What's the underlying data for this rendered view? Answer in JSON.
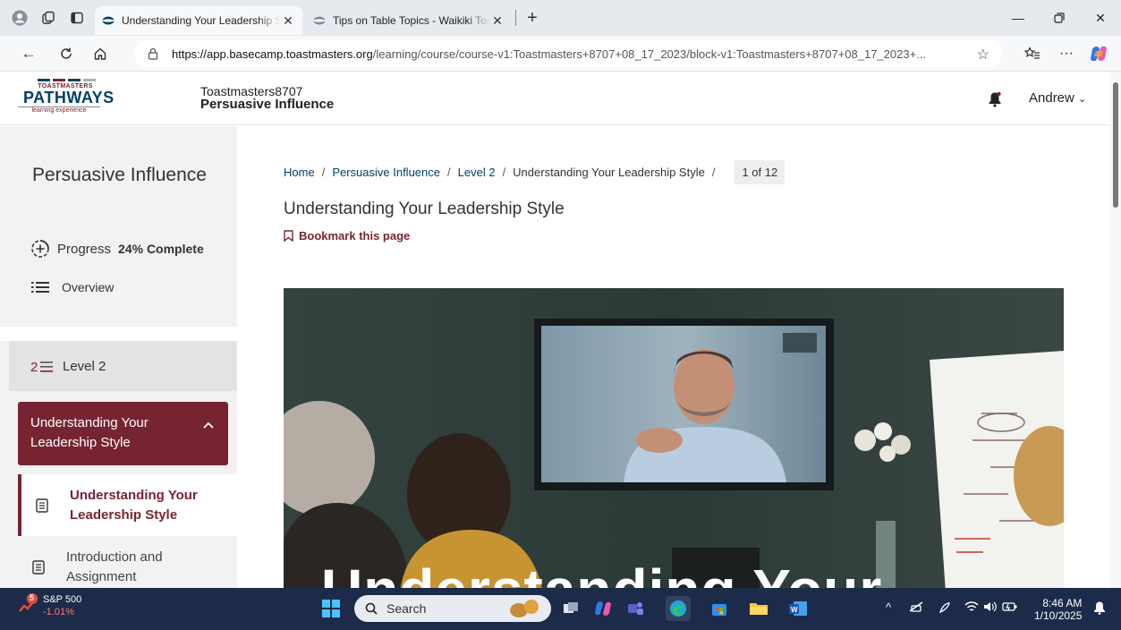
{
  "browser": {
    "tabs": [
      {
        "title": "Understanding Your Leadership Style",
        "active": true
      },
      {
        "title": "Tips on Table Topics - Waikiki Toastmasters",
        "active": false
      }
    ],
    "url_host": "https://app.basecamp.toastmasters.org",
    "url_path": "/learning/course/course-v1:Toastmasters+8707+08_17_2023/block-v1:Toastmasters+8707+08_17_2023+..."
  },
  "header": {
    "logo_top": "TOASTMASTERS",
    "logo_main": "PATHWAYS",
    "logo_sub": "learning experience",
    "course_org": "Toastmasters8707",
    "course_name": "Persuasive Influence",
    "user_name": "Andrew"
  },
  "sidebar": {
    "title": "Persuasive Influence",
    "progress_label": "Progress",
    "progress_value": "24% Complete",
    "progress_fraction": 0.24,
    "overview_label": "Overview",
    "level_label": "Level 2",
    "section_label": "Understanding Your Leadership Style",
    "items": [
      {
        "label": "Understanding Your Leadership Style",
        "active": true
      },
      {
        "label": "Introduction and Assignment",
        "active": false
      }
    ]
  },
  "main": {
    "breadcrumb": {
      "home": "Home",
      "course": "Persuasive Influence",
      "level": "Level 2",
      "current": "Understanding Your Leadership Style",
      "pager": "1 of 12"
    },
    "title": "Understanding Your Leadership Style",
    "bookmark_label": "Bookmark this page",
    "hero_text": "Understanding Your"
  },
  "taskbar": {
    "stock_name": "S&P 500",
    "stock_change": "-1.01%",
    "stock_badge": "5",
    "search_placeholder": "Search",
    "time": "8:46 AM",
    "date": "1/10/2025"
  },
  "colors": {
    "brand_maroon": "#772432",
    "brand_blue": "#004165",
    "taskbar": "#1d2b4a"
  },
  "icons": [
    "profile-icon",
    "workspaces-icon",
    "tab-actions-icon",
    "refresh-icon",
    "home-icon",
    "favorites-icon",
    "copilot-icon",
    "bell-icon",
    "progress-icon",
    "overview-list-icon",
    "level-icon",
    "chevron-up-icon",
    "document-icon",
    "bookmark-icon",
    "windows-start-icon",
    "search-icon"
  ]
}
